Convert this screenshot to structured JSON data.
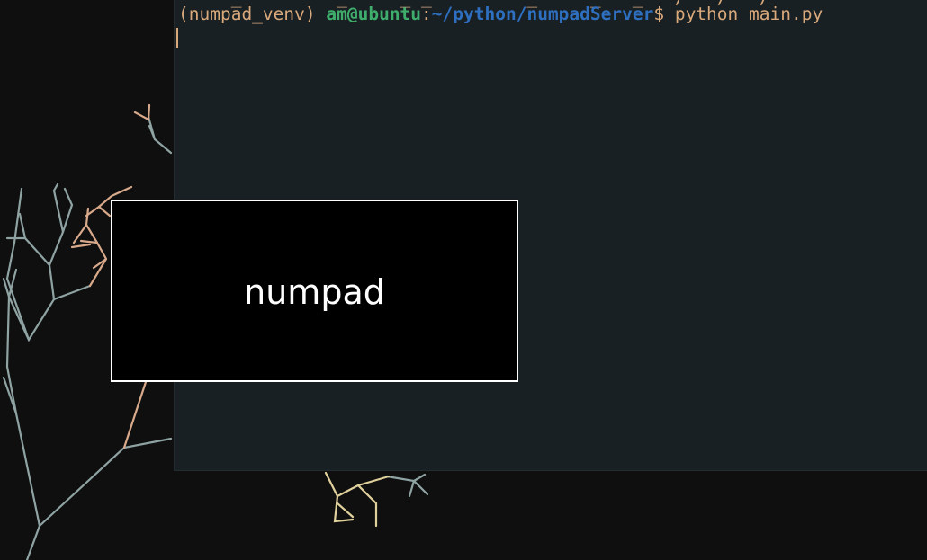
{
  "terminal": {
    "venv": "(numpad_venv) ",
    "user_host": "am@ubuntu",
    "colon": ":",
    "path": "~/python/numpadServer",
    "dollar": "$ ",
    "command": "python main.py"
  },
  "numpad_window": {
    "label": "numpad"
  },
  "colors": {
    "terminal_bg": "#182023",
    "desktop_bg": "#0f0f0f",
    "prompt_text": "#d9a97c",
    "user_green": "#3fae6c",
    "path_blue": "#2e6fc0",
    "numpad_bg": "#000000",
    "numpad_border": "#ffffff"
  }
}
